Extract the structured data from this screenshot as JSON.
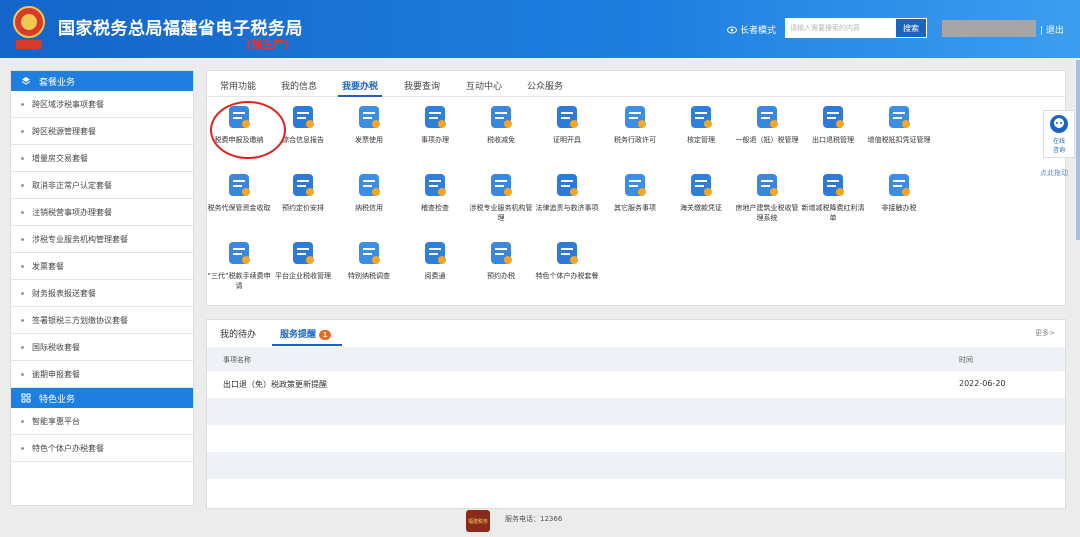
{
  "header": {
    "title": "国家税务总局福建省电子税务局",
    "subtitle": "(预生产)",
    "emblem_text": "税务总局",
    "elder_mode": "长者模式",
    "search_placeholder": "请输入需要搜索的内容",
    "search_button": "搜索",
    "logout": "退出",
    "separator": "|"
  },
  "sidebar": {
    "section1": "套餐业务",
    "items1": [
      "跨区域涉税事项套餐",
      "跨区税源管理套餐",
      "增量房交易套餐",
      "取消非正常户认定套餐",
      "注销税营事项办理套餐",
      "涉税专业服务机构管理套餐",
      "发票套餐",
      "财务报表报送套餐",
      "签署银税三方划缴协议套餐",
      "国际税收套餐",
      "逾期申报套餐"
    ],
    "section2": "特色业务",
    "items2": [
      "智能享惠平台",
      "特色个体户办税套餐"
    ]
  },
  "tabs": [
    "常用功能",
    "我的信息",
    "我要办税",
    "我要查询",
    "互动中心",
    "公众服务"
  ],
  "active_tab": "我要办税",
  "grid": {
    "row1": [
      "税费申报及缴纳",
      "综合信息报告",
      "发票使用",
      "事项办理",
      "税收减免",
      "证明开具",
      "税务行政许可",
      "核定管理",
      "一般退（抵）税管理",
      "出口退税管理",
      "增值税抵扣凭证管理"
    ],
    "row2": [
      "税务代保管资金收取",
      "预约定价安排",
      "纳税信用",
      "稽查检查",
      "涉税专业服务机构管理",
      "法律追责与救济事项",
      "其它服务事项",
      "海关缴款凭证",
      "房地产建筑业税收管理系统",
      "新增减税降费红利清单",
      "非接触办税"
    ],
    "row3": [
      "“三代”税款手续费申请",
      "平台企业税收管理",
      "特别纳税调查",
      "阅费通",
      "预约办税",
      "特色个体户办税套餐"
    ]
  },
  "panel": {
    "tab1": "我的待办",
    "tab2": "服务提醒",
    "badge": "1",
    "more": "更多>",
    "col_name": "事项名称",
    "col_time": "时间",
    "rows": [
      {
        "name": "出口退（免）税政策更新提醒",
        "time": "2022-06-20"
      }
    ]
  },
  "online": {
    "line1": "在线",
    "line2": "咨询",
    "drag": "点此拖动"
  },
  "footer": {
    "phone": "服务电话：12366",
    "seal": "福建税务"
  },
  "colors": {
    "primary": "#1f7fe0",
    "accent": "#1a64c0",
    "highlight": "#e02020"
  }
}
